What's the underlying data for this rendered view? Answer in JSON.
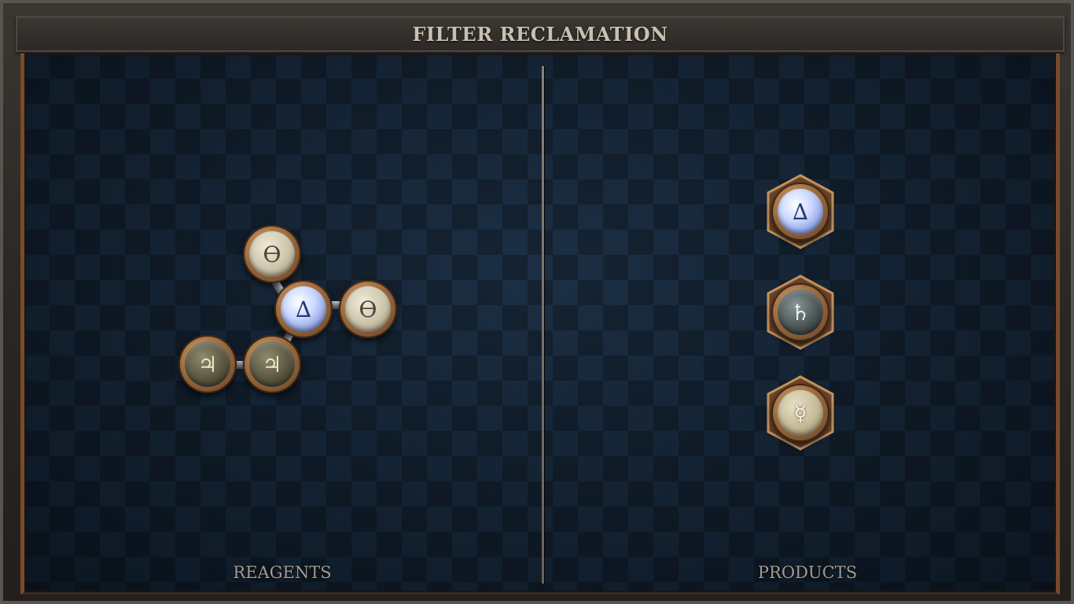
{
  "header": {
    "title": "FILTER RECLAMATION"
  },
  "reagents": {
    "label": "REAGENTS",
    "atoms": [
      {
        "element": "salt",
        "symbol": "ϴ"
      },
      {
        "element": "air",
        "symbol": "∆"
      },
      {
        "element": "salt",
        "symbol": "ϴ"
      },
      {
        "element": "tin",
        "symbol": "♃"
      },
      {
        "element": "tin",
        "symbol": "♃"
      }
    ]
  },
  "products": {
    "label": "PRODUCTS",
    "atoms": [
      {
        "element": "air",
        "symbol": "∆"
      },
      {
        "element": "lead",
        "symbol": "♄"
      },
      {
        "element": "mercury",
        "symbol": "☿"
      }
    ]
  }
}
